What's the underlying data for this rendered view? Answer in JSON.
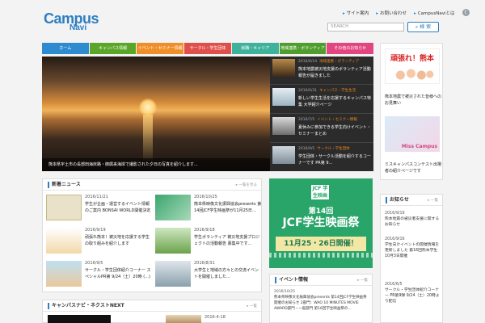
{
  "logo": {
    "line1": "Campus",
    "line2": "Navi"
  },
  "topnav": {
    "items": [
      "サイト案内",
      "お問い合わせ",
      "CampusNaviとは"
    ]
  },
  "search": {
    "placeholder": "SEARCH",
    "button": "検 索"
  },
  "nav": [
    {
      "label": "ホーム",
      "color": "#2e8bd0"
    },
    {
      "label": "キャンパス情報",
      "color": "#5aa628"
    },
    {
      "label": "イベント・セミナー情報",
      "color": "#f08f2a"
    },
    {
      "label": "サークル・学生団体",
      "color": "#e0504b"
    },
    {
      "label": "就職・キャリア",
      "color": "#3fb29c"
    },
    {
      "label": "地域連携・ボランティア",
      "color": "#4f9d2d"
    },
    {
      "label": "その他のお知らせ",
      "color": "#e2457f"
    }
  ],
  "hero": {
    "caption": "熊本県宇土市の長部田海床路・御輿来海岸で撮影された夕日の写真を紹介します..."
  },
  "side_news": [
    {
      "date": "2016/6/14",
      "tag": "地域連携・ボランティア",
      "title": "熊本地震被災地支援のボランティア活動報告が届きました"
    },
    {
      "date": "2016/6/31",
      "tag": "キャンパス・学生生活",
      "title": "新しい学生生活を応援するキャンパス特集 大学紹介ページ"
    },
    {
      "date": "2016/7/5",
      "tag": "イベント・セミナー情報",
      "title": "夏休みに参加できる学生向けイベント・セミナーまとめ"
    },
    {
      "date": "2016/9/5",
      "tag": "サークル・学生団体",
      "title": "学生団体・サークル活動を紹介するコーナーです PR第 9..."
    }
  ],
  "news": {
    "title": "新着ニュース",
    "more": "一覧を見る",
    "items": [
      {
        "date": "2016/11/21",
        "title": "学生が企画・運営するイベント情報のご案内 BONSAI WORLD開催決定"
      },
      {
        "date": "2016/10/25",
        "title": "熊本県映像文化振興協会presents 第14回JCF学生映画祭が11月25日..."
      },
      {
        "date": "2016/9/19",
        "title": "頑張れ熊本！被災地を応援する学生の取り組みを紹介します"
      },
      {
        "date": "2016/9/18",
        "title": "学生ボランティア 被災地支援プロジェクトの活動報告 募集中です..."
      },
      {
        "date": "2016/9/5",
        "title": "サークル・学生団体紹介コーナー スペシャルPR第 9/24（土）20時 (...)"
      },
      {
        "date": "2016/8/31",
        "title": "大学生と地域の方々との交流イベントを開催しました..."
      }
    ]
  },
  "next": {
    "title": "キャンパスナビ・ネクストNEXT",
    "more": "一覧",
    "date": "2016-4-18"
  },
  "right_banners": [
    {
      "text": "頑張れ！熊本",
      "caption": "熊本地震で被災された皆様へのお見舞い"
    },
    {
      "text": "Miss Campus",
      "caption": "ミスキャンパスコンテスト出場者の紹介ページです"
    }
  ],
  "jcf": {
    "logo": "JCF 学生映画祭",
    "line1": "第14回",
    "line2": "JCF学生映画祭",
    "line3": "11月25・26日開催！"
  },
  "events": {
    "title": "イベント情報",
    "more": "一覧",
    "date": "2016/10/25",
    "text": "熊本県映像文化振興協会presents 第14回JCF学生映画祭開催のお知らせ 2部門：WAO 10 MINUTES MOVIE AWARD部門・一般部門 第16回学生映画祭の..."
  },
  "right_info": {
    "title": "お知らせ",
    "more": "一覧",
    "items": [
      {
        "date": "2016/9/19",
        "title": "熊本地震の被災者支援に関するお知らせ"
      },
      {
        "date": "2016/9/16",
        "title": "学生向けイベントの開催情報を更新しました 第16回熊本学生 10月3日開催"
      },
      {
        "date": "2016/6/5",
        "title": "サークル・学生団体紹介コーナー PR第9弾 9/24（土）20時より配信"
      }
    ]
  }
}
